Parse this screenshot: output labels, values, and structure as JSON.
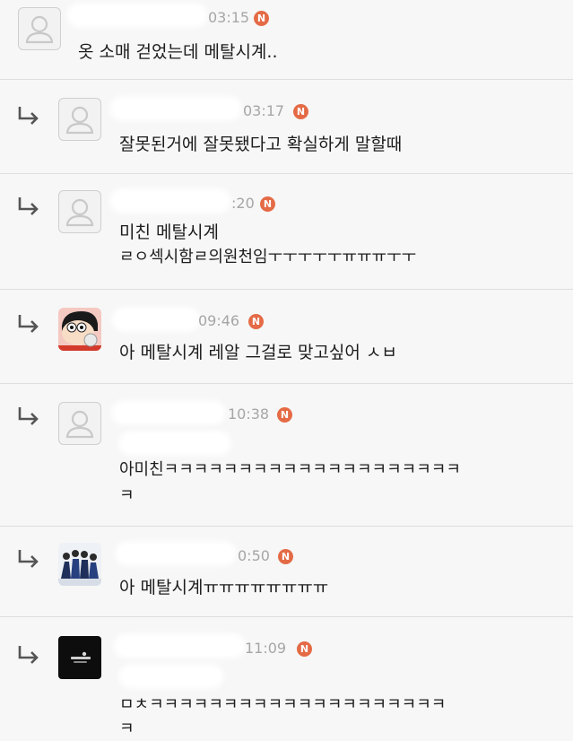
{
  "colors": {
    "background": "#f7f7f7",
    "badge": "#e46b46",
    "time": "#a6a6a6",
    "divider": "#dedede"
  },
  "badge_label": "N",
  "comments": [
    {
      "time": "03:15",
      "text": "옷 소매 걷었는데 메탈시계..",
      "avatar": "default-avatar-icon",
      "reply": false
    },
    {
      "time": "03:17",
      "text": "잘못된거에 잘못됐다고 확실하게 말할때",
      "avatar": "default-avatar-icon",
      "reply": true
    },
    {
      "time": ":20",
      "text_line1": "미친 메탈시계",
      "text_line2": "ㄹㅇ섹시함ㄹ의원천임ㅜㅜㅜㅜㅜㅠㅠㅠㅜㅜ",
      "avatar": "default-avatar-icon",
      "reply": true
    },
    {
      "time": "09:46",
      "text": "아 메탈시계 레알 그걸로 맞고싶어 ㅅㅂ",
      "avatar": "cartoon-avatar",
      "reply": true
    },
    {
      "time": "10:38",
      "text_line1": "아미친ㅋㅋㅋㅋㅋㅋㅋㅋㅋㅋㅋㅋㅋㅋㅋㅋㅋㅋㅋㅋ",
      "text_line2": "ㅋ",
      "avatar": "default-avatar-icon",
      "reply": true
    },
    {
      "time": "0:50",
      "text": "아 메탈시계ㅠㅠㅠㅠㅠㅠㅠㅠ",
      "avatar": "group-photo-avatar",
      "reply": true
    },
    {
      "time": "11:09",
      "text_line1": "ㅁㅊㅋㅋㅋㅋㅋㅋㅋㅋㅋㅋㅋㅋㅋㅋㅋㅋㅋㅋㅋㅋ",
      "text_line2": "ㅋ",
      "avatar": "dark-logo-avatar",
      "reply": true
    }
  ]
}
